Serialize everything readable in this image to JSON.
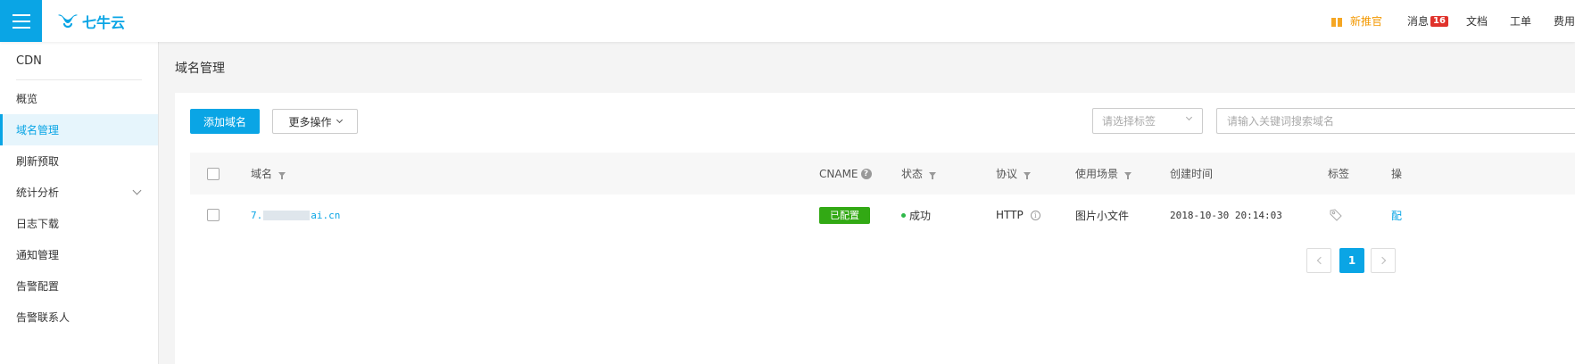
{
  "header": {
    "logo_text": "七牛云",
    "nav": {
      "new_user": "新推官",
      "messages": "消息",
      "message_count": "16",
      "docs": "文档",
      "tickets": "工单",
      "billing": "费用"
    }
  },
  "sidebar": {
    "title": "CDN",
    "items": [
      {
        "label": "概览"
      },
      {
        "label": "域名管理"
      },
      {
        "label": "刷新预取"
      },
      {
        "label": "统计分析"
      },
      {
        "label": "日志下载"
      },
      {
        "label": "通知管理"
      },
      {
        "label": "告警配置"
      },
      {
        "label": "告警联系人"
      }
    ]
  },
  "main": {
    "title": "域名管理",
    "add_button": "添加域名",
    "more_button": "更多操作",
    "tag_select_placeholder": "请选择标签",
    "search_placeholder": "请输入关键词搜索域名"
  },
  "table": {
    "headers": {
      "domain": "域名",
      "cname": "CNAME",
      "status": "状态",
      "protocol": "协议",
      "scenario": "使用场景",
      "created": "创建时间",
      "tags": "标签",
      "ops": "操"
    },
    "rows": [
      {
        "domain_prefix": "7.",
        "domain_suffix": "ai.cn",
        "cname": "已配置",
        "status": "成功",
        "protocol": "HTTP",
        "scenario": "图片小文件",
        "created": "2018-10-30 20:14:03",
        "op": "配"
      }
    ]
  },
  "pagination": {
    "current": "1"
  },
  "colors": {
    "primary": "#0aa5e5",
    "success": "#32a914",
    "badge": "#e0322b",
    "gift": "#f39800"
  }
}
